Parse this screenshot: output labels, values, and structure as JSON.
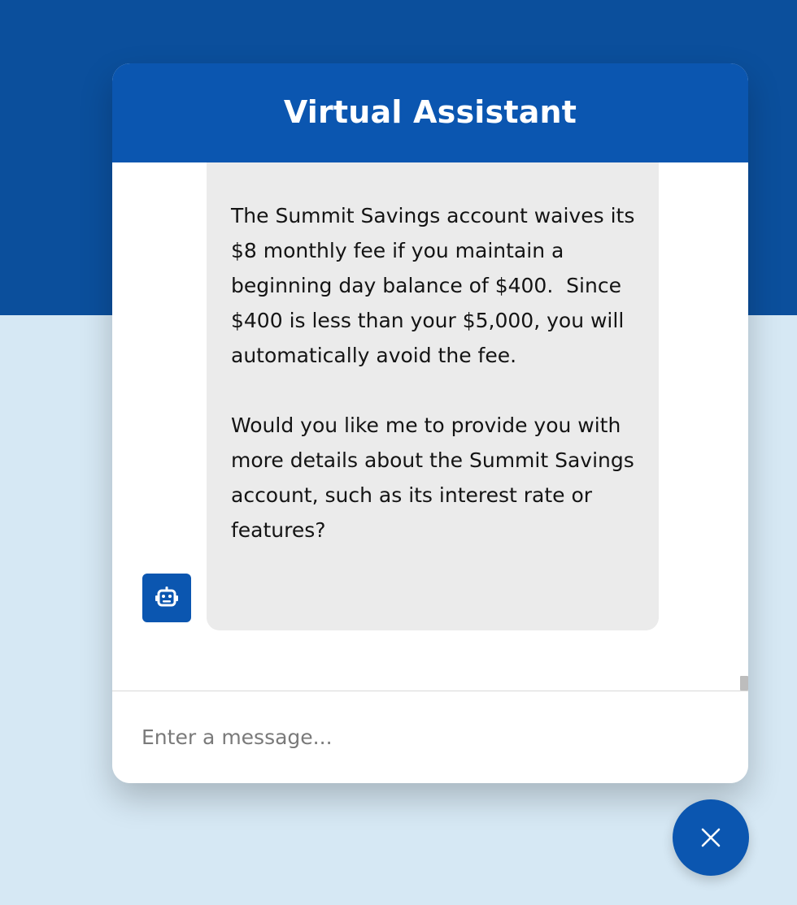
{
  "colors": {
    "brand_blue": "#0b56b0",
    "background_top": "#0b4f9c",
    "background_bottom": "#d6e8f4",
    "bubble_background": "#ebebeb"
  },
  "chat": {
    "title": "Virtual Assistant",
    "bot_message": {
      "paragraph_1": "The Summit Savings account waives its $8 monthly fee if you maintain a beginning day balance of $400.  Since $400 is less than your $5,000, you will automatically avoid the fee.",
      "paragraph_2": "Would you like me to provide you with more details about the Summit Savings account, such as its interest rate or features?"
    },
    "input": {
      "placeholder": "Enter a message...",
      "value": ""
    }
  },
  "icons": {
    "bot_avatar": "robot-icon",
    "close_button": "close-icon"
  }
}
